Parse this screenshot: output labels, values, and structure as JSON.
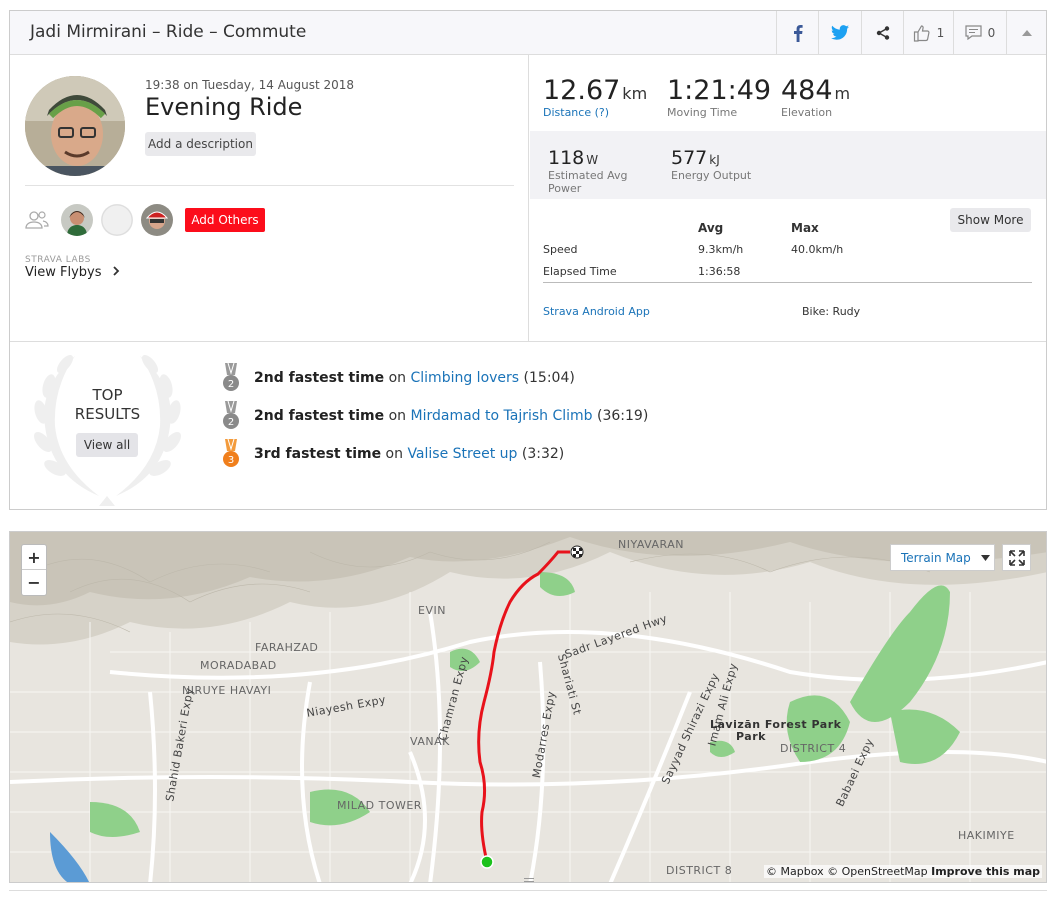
{
  "header": {
    "title": "Jadi Mirmirani – Ride – Commute",
    "kudos_count": "1",
    "comment_count": "0"
  },
  "activity": {
    "datetime": "19:38 on Tuesday, 14 August 2018",
    "name": "Evening Ride",
    "add_description_label": "Add a description",
    "add_others_label": "Add Others",
    "labs_label": "STRAVA LABS",
    "flybys_label": "View Flybys"
  },
  "stats": {
    "distance": {
      "value": "12.67",
      "unit": "km",
      "label": "Distance (?)"
    },
    "moving_time": {
      "value": "1:21:49",
      "label": "Moving Time"
    },
    "elevation": {
      "value": "484",
      "unit": "m",
      "label": "Elevation"
    },
    "power": {
      "value": "118",
      "unit": "W",
      "label_line1": "Estimated Avg",
      "label_line2": "Power"
    },
    "energy": {
      "value": "577",
      "unit": "kJ",
      "label": "Energy Output"
    }
  },
  "table": {
    "col_avg": "Avg",
    "col_max": "Max",
    "show_more_label": "Show More",
    "rows": [
      {
        "label": "Speed",
        "avg": "9.3km/h",
        "max": "40.0km/h"
      },
      {
        "label": "Elapsed Time",
        "avg": "1:36:58",
        "max": ""
      }
    ],
    "app_label": "Strava Android App",
    "bike_label": "Bike: Rudy"
  },
  "results": {
    "top_line1": "TOP",
    "top_line2": "RESULTS",
    "view_all_label": "View all",
    "items": [
      {
        "rank": "2",
        "rank_text": "2nd fastest time",
        "on": "on",
        "segment": "Climbing lovers",
        "time": "(15:04)",
        "color": "#8a8a8a"
      },
      {
        "rank": "2",
        "rank_text": "2nd fastest time",
        "on": "on",
        "segment": "Mirdamad to Tajrish Climb",
        "time": "(36:19)",
        "color": "#8a8a8a"
      },
      {
        "rank": "3",
        "rank_text": "3rd fastest time",
        "on": "on",
        "segment": "Valise Street up",
        "time": "(3:32)",
        "color": "#f07f1c"
      }
    ]
  },
  "map": {
    "zoom_in": "+",
    "zoom_out": "−",
    "terrain_label": "Terrain Map",
    "attribution_prefix": "© Mapbox © OpenStreetMap",
    "improve_label": "Improve this map",
    "labels": {
      "niyavaran": "NIYAVARAN",
      "evin": "EVIN",
      "farahzad": "FARAHZAD",
      "moradabad": "MORADABAD",
      "niruye": "NIRUYE HAVAYI",
      "vanak": "VANAK",
      "milad": "MILAD TOWER",
      "district4": "DISTRICT 4",
      "district8": "DISTRICT 8",
      "hakimiye": "HAKIMIYE",
      "sadr": "Sadr Layered Hwy",
      "niayesh": "Niayesh Expy",
      "chamran": "Chamran Expy",
      "modares": "Modarres Expy",
      "shariati": "Shariati St",
      "sayyad": "Sayyad Shirazi Expy",
      "imamali": "Imam Ali Expy",
      "babaei": "Babaei Expy",
      "bakeri": "Shahid Bakeri Expy",
      "lavizan": "Lavizān Forest Park",
      "lavizan2": "Park"
    },
    "colors": {
      "route": "#e8121b",
      "park": "#8fd08a",
      "start": "#1cc21c"
    }
  }
}
